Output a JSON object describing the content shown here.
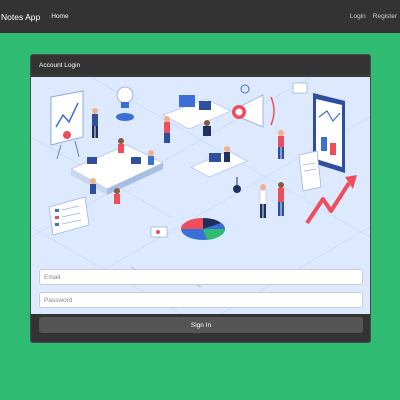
{
  "navbar": {
    "brand": "Notes App",
    "home": "Home",
    "login": "Login",
    "register": "Register"
  },
  "panel": {
    "title": "Account Login",
    "hero_image": "isometric office teamwork illustration",
    "email_placeholder": "Email",
    "password_placeholder": "Password",
    "signin_label": "Sign In"
  },
  "colors": {
    "background": "#2fbc72",
    "navbar": "#333333",
    "panel": "#333333",
    "button": "#555555",
    "hero_bg": "#dde9ff"
  }
}
